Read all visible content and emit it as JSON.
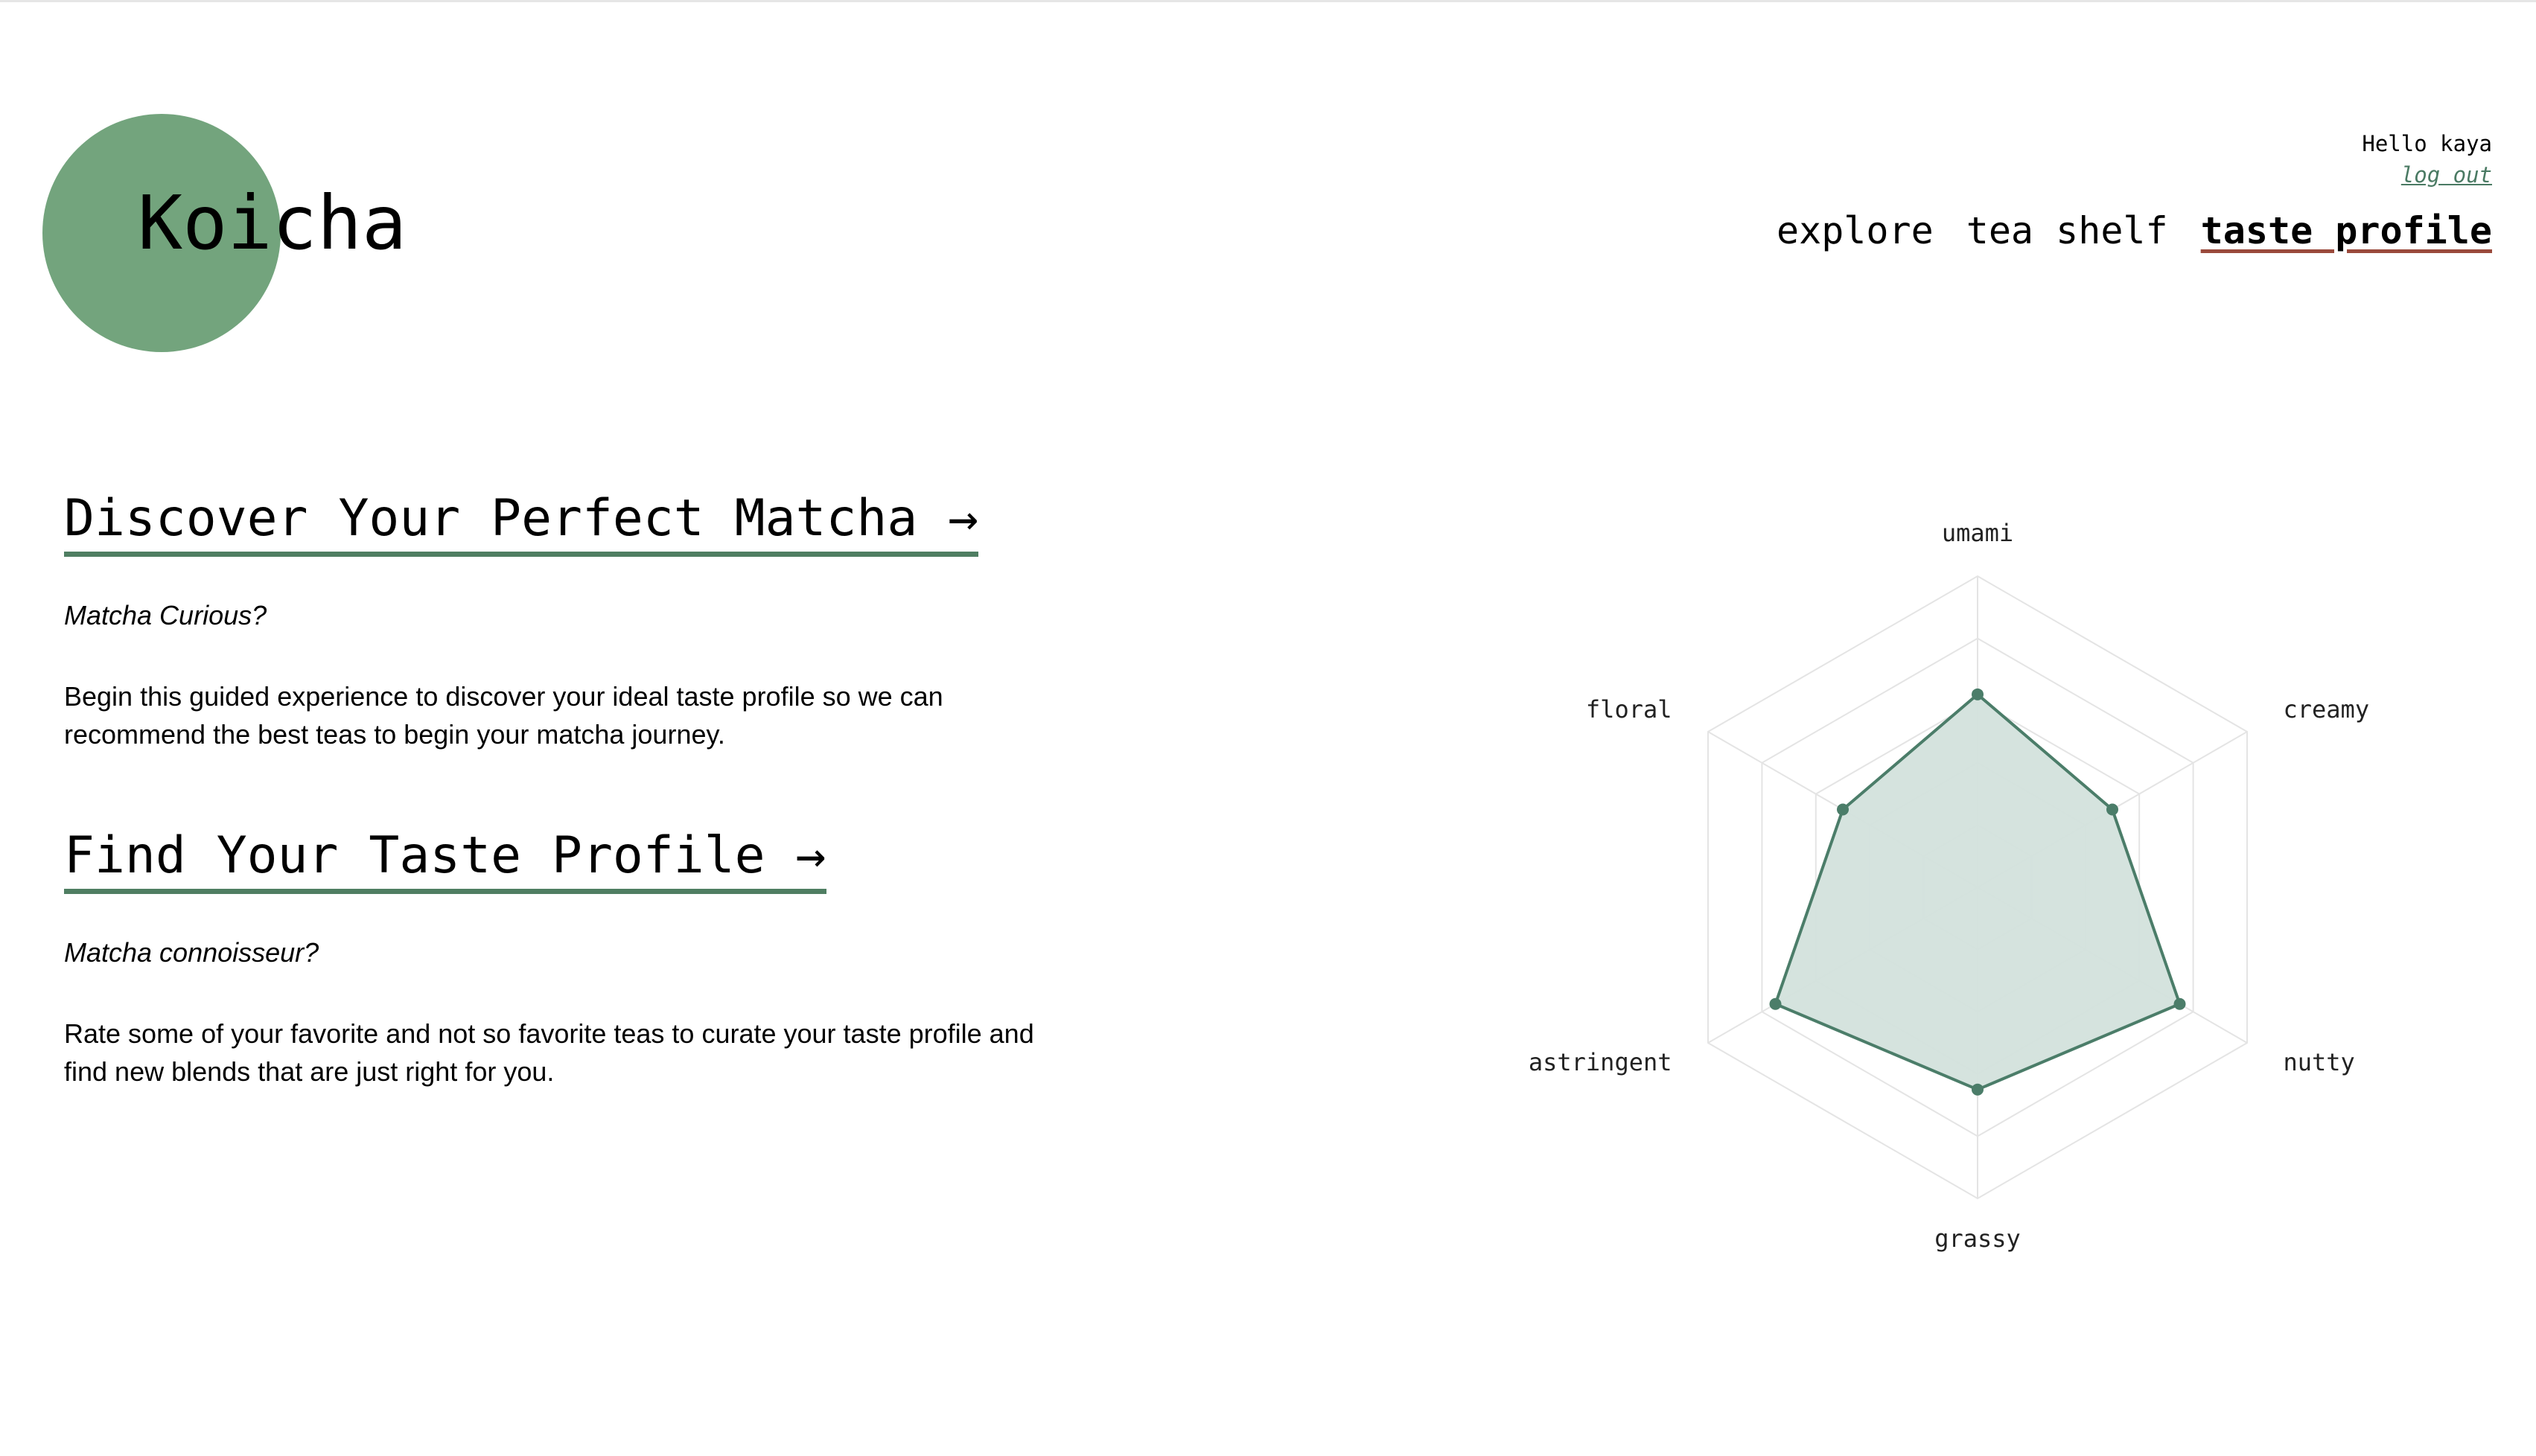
{
  "colors": {
    "brand_green": "#73a47d",
    "link_green": "#4a7a63",
    "heading_underline": "#4f7e62",
    "active_underline": "#9a4a3c",
    "radar_stroke": "#4b7d69",
    "radar_fill": "#d3e1dc",
    "radar_grid": "#e4e4e4"
  },
  "header": {
    "logo": "Koicha",
    "greeting": "Hello kaya",
    "logout": "log out"
  },
  "nav": {
    "items": [
      "explore",
      "tea shelf",
      "taste profile"
    ],
    "active": "taste profile"
  },
  "cards": [
    {
      "heading": "Discover Your Perfect Matcha →",
      "kicker": "Matcha Curious?",
      "body": "Begin this guided experience to discover your ideal taste profile so we can recommend the best teas to begin your matcha journey."
    },
    {
      "heading": "Find Your Taste Profile →",
      "kicker": "Matcha connoisseur?",
      "body": "Rate some of your favorite and not so favorite teas to curate your taste profile and find new blends that are just right for you."
    }
  ],
  "chart_data": {
    "type": "radar",
    "axes": [
      "umami",
      "creamy",
      "nutty",
      "grassy",
      "astringent",
      "floral"
    ],
    "values": [
      0.62,
      0.5,
      0.75,
      0.65,
      0.75,
      0.5
    ],
    "range": [
      0,
      1
    ],
    "grid_levels": 5
  }
}
